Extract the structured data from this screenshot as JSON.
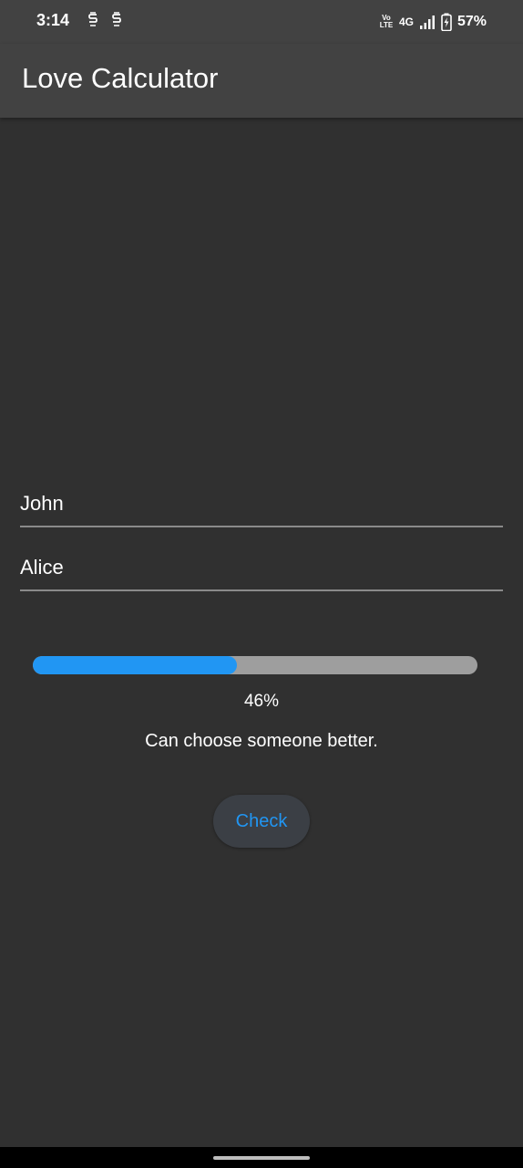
{
  "status_bar": {
    "time": "3:14",
    "notification_icons": [
      "s-logo-icon",
      "s-logo-icon"
    ],
    "volte_label": "Vo LTE",
    "network_label": "4G",
    "battery_percent": "57%",
    "battery_level": 0.57
  },
  "app_bar": {
    "title": "Love Calculator"
  },
  "form": {
    "name1_value": "John",
    "name2_value": "Alice"
  },
  "result": {
    "progress": 0.46,
    "percent_label": "46%",
    "message": "Can choose someone better."
  },
  "actions": {
    "check_label": "Check"
  },
  "colors": {
    "background": "#303030",
    "app_bar": "#424242",
    "accent": "#2196f3",
    "track": "#9e9e9e",
    "button_bg": "#3b3f45"
  }
}
